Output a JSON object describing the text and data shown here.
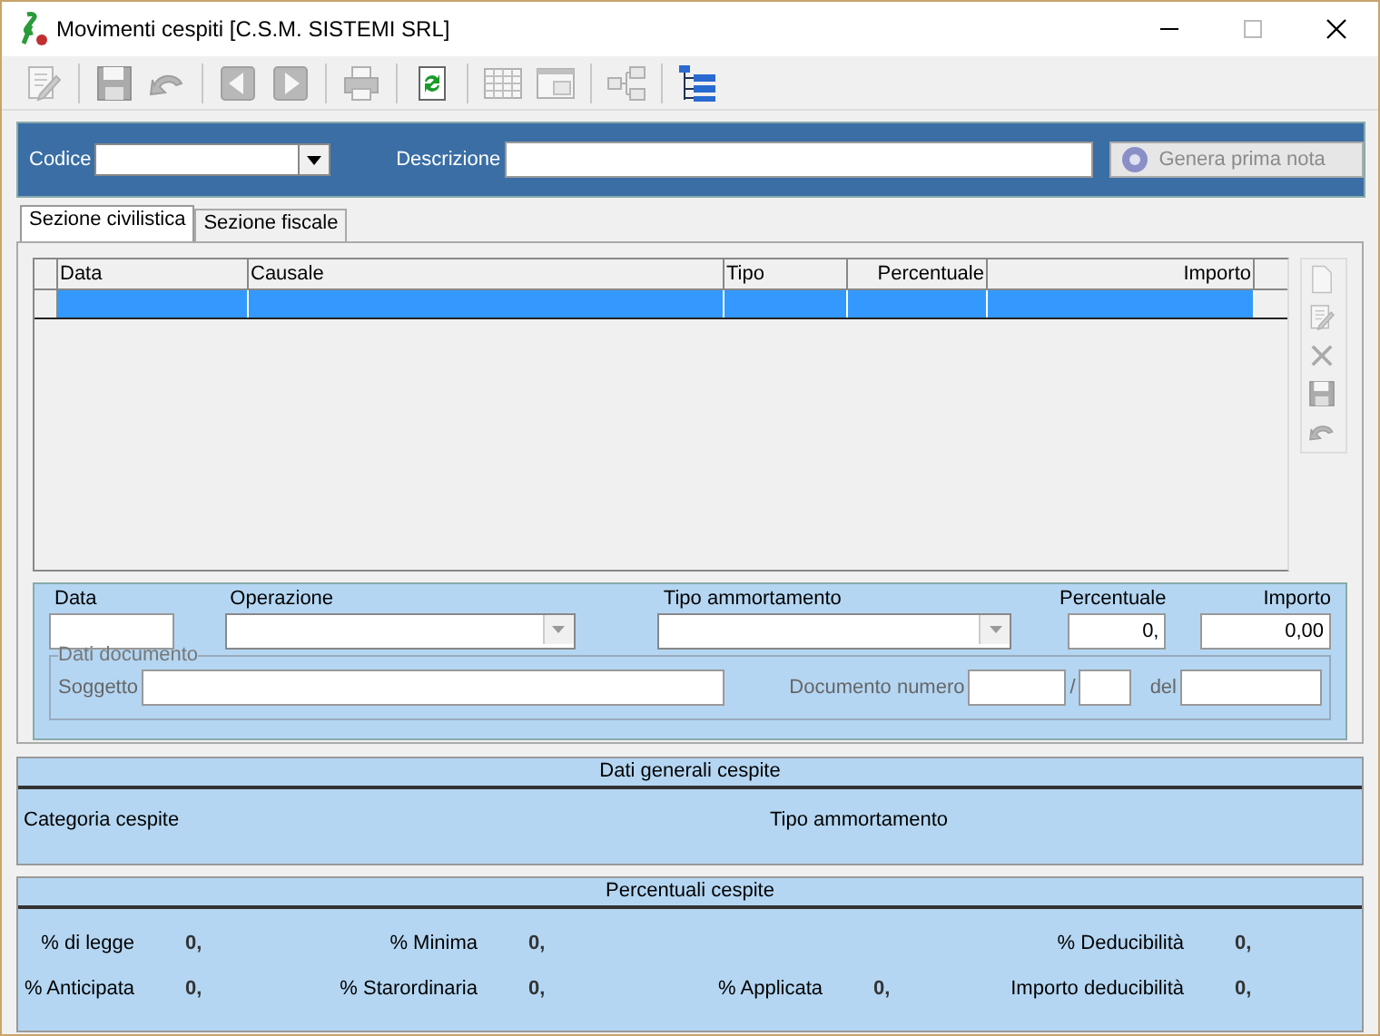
{
  "window": {
    "title": "Movimenti cespiti [C.S.M. SISTEMI SRL]"
  },
  "toolbar": [
    {
      "kind": "edit",
      "disabled": true
    },
    {
      "kind": "sep"
    },
    {
      "kind": "save",
      "disabled": true
    },
    {
      "kind": "undo",
      "disabled": true
    },
    {
      "kind": "sep"
    },
    {
      "kind": "prev",
      "disabled": true
    },
    {
      "kind": "next",
      "disabled": true
    },
    {
      "kind": "sep"
    },
    {
      "kind": "print",
      "disabled": true
    },
    {
      "kind": "sep"
    },
    {
      "kind": "refresh",
      "disabled": false
    },
    {
      "kind": "sep"
    },
    {
      "kind": "grid",
      "disabled": true
    },
    {
      "kind": "form",
      "disabled": true
    },
    {
      "kind": "sep"
    },
    {
      "kind": "diagram",
      "disabled": true
    },
    {
      "kind": "sep"
    },
    {
      "kind": "tree",
      "disabled": false
    }
  ],
  "header": {
    "code_label": "Codice",
    "description_label": "Descrizione",
    "generate_button": {
      "label": "Genera prima nota",
      "disabled": true
    }
  },
  "tabs": [
    {
      "label": "Sezione civilistica",
      "selected": true
    },
    {
      "label": "Sezione fiscale",
      "selected": false
    }
  ],
  "table": {
    "columns": [
      {
        "label": "Data",
        "kind": "text"
      },
      {
        "label": "Causale",
        "kind": "text"
      },
      {
        "label": "Tipo",
        "kind": "text"
      },
      {
        "label": "Percentuale",
        "kind": "number"
      },
      {
        "label": "Importo",
        "kind": "number"
      }
    ],
    "rows": [
      {
        "selected": true
      }
    ]
  },
  "side_buttons": [
    {
      "kind": "new",
      "disabled": true
    },
    {
      "kind": "edit",
      "disabled": true
    },
    {
      "kind": "delete",
      "disabled": true
    },
    {
      "kind": "save",
      "disabled": true
    },
    {
      "kind": "undo",
      "disabled": true
    }
  ],
  "form": {
    "fields": [
      {
        "kind": "text",
        "label": "Data"
      },
      {
        "kind": "combo",
        "label": "Operazione"
      },
      {
        "kind": "combo",
        "label": "Tipo ammortamento"
      },
      {
        "kind": "number",
        "label": "Percentuale",
        "value": "0,"
      },
      {
        "kind": "number",
        "label": "Importo",
        "value": "0,00"
      }
    ],
    "document": {
      "title": "Dati documento",
      "subject_label": "Soggetto",
      "number_label": "Documento numero",
      "slash": "/",
      "date_label": "del"
    }
  },
  "general": {
    "title": "Dati generali cespite",
    "category_label": "Categoria cespite",
    "depreciation_label": "Tipo ammortamento"
  },
  "percentages": {
    "title": "Percentuali cespite",
    "rows": [
      [
        {
          "label": "% di legge",
          "value": "0,"
        },
        {
          "label": "% Minima",
          "value": "0,"
        },
        null,
        {
          "label": "% Deducibilità",
          "value": "0,"
        }
      ],
      [
        {
          "label": "% Anticipata",
          "value": "0,"
        },
        {
          "label": "% Starordinaria",
          "value": "0,"
        },
        {
          "label": "% Applicata",
          "value": "0,"
        },
        {
          "label": "Importo deducibilità",
          "value": "0,"
        }
      ]
    ]
  }
}
